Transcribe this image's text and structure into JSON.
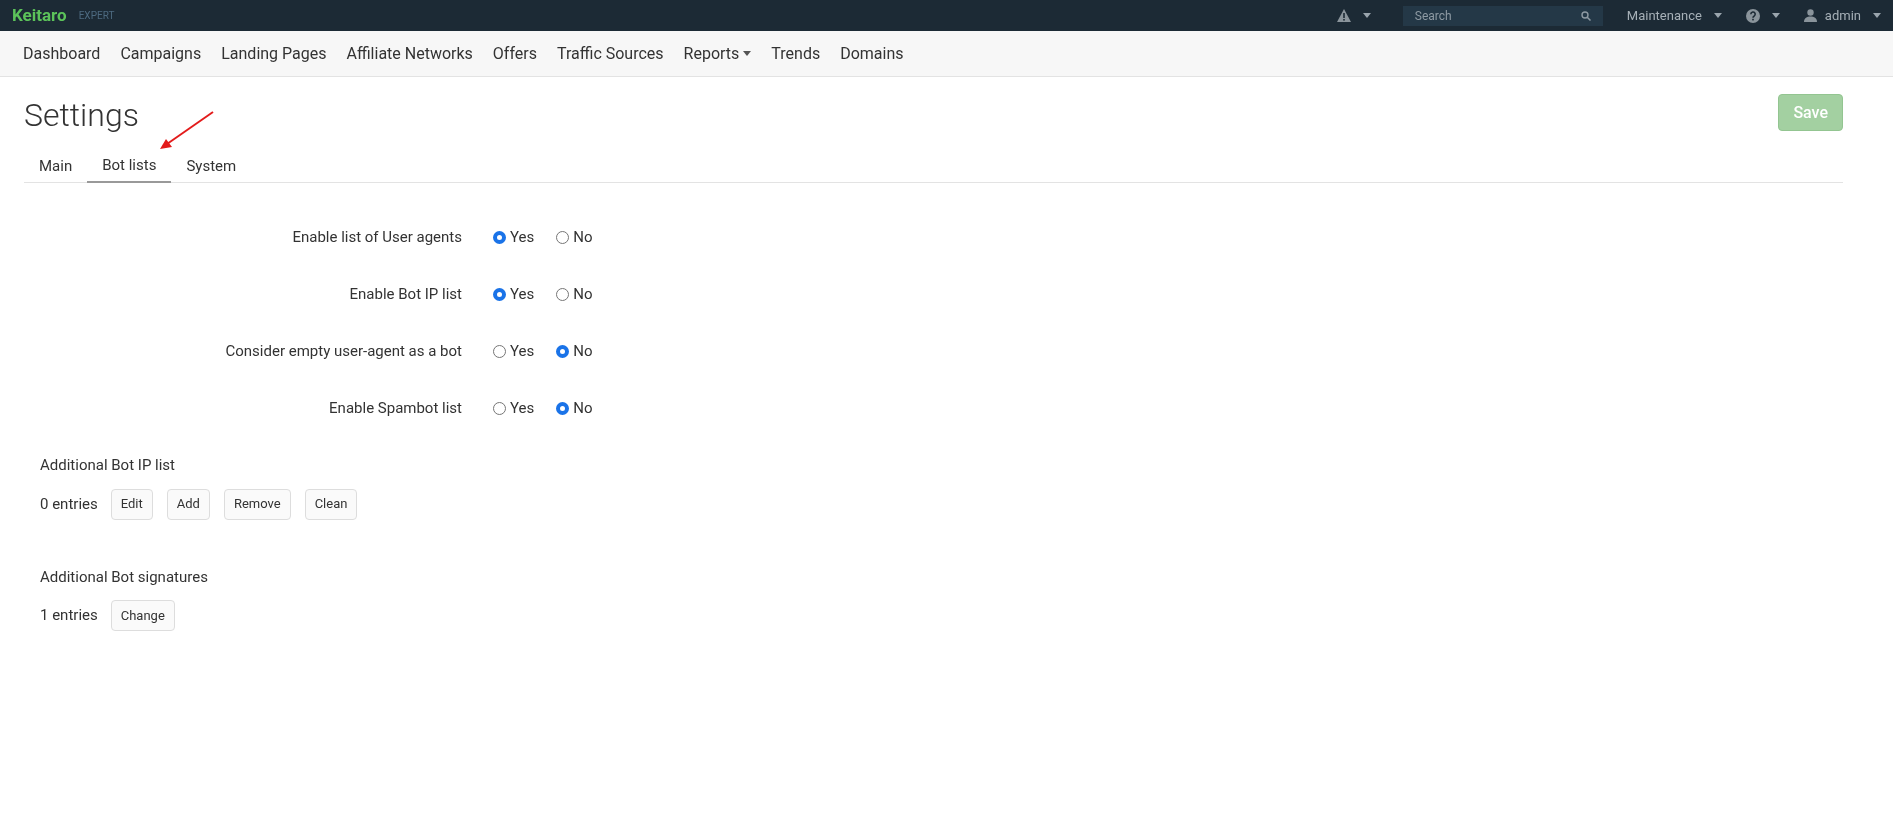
{
  "topbar": {
    "logo": "Keitaro",
    "edition": "EXPERT",
    "search": {
      "placeholder": "Search"
    },
    "menus": [
      {
        "kind": "alert"
      },
      {
        "kind": "text",
        "label": "Maintenance"
      },
      {
        "kind": "help"
      },
      {
        "kind": "user",
        "label": "admin"
      }
    ]
  },
  "nav": [
    {
      "label": "Dashboard",
      "dropdown": false
    },
    {
      "label": "Campaigns",
      "dropdown": false
    },
    {
      "label": "Landing Pages",
      "dropdown": false
    },
    {
      "label": "Affiliate Networks",
      "dropdown": false
    },
    {
      "label": "Offers",
      "dropdown": false
    },
    {
      "label": "Traffic Sources",
      "dropdown": false
    },
    {
      "label": "Reports",
      "dropdown": true
    },
    {
      "label": "Trends",
      "dropdown": false
    },
    {
      "label": "Domains",
      "dropdown": false
    }
  ],
  "page": {
    "title": "Settings",
    "save_button": {
      "label": "Save",
      "disabled": true
    }
  },
  "tabs": [
    {
      "label": "Main",
      "selected": false
    },
    {
      "label": "Bot lists",
      "selected": true
    },
    {
      "label": "System",
      "selected": false
    }
  ],
  "annotation": {
    "kind": "arrow"
  },
  "settings": [
    {
      "label": "Enable list of User agents",
      "options": [
        {
          "label": "Yes",
          "selected": true
        },
        {
          "label": "No",
          "selected": false
        }
      ]
    },
    {
      "label": "Enable Bot IP list",
      "options": [
        {
          "label": "Yes",
          "selected": true
        },
        {
          "label": "No",
          "selected": false
        }
      ]
    },
    {
      "label": "Consider empty user-agent as a bot",
      "options": [
        {
          "label": "Yes",
          "selected": false
        },
        {
          "label": "No",
          "selected": true
        }
      ]
    },
    {
      "label": "Enable Spambot list",
      "options": [
        {
          "label": "Yes",
          "selected": false
        },
        {
          "label": "No",
          "selected": true
        }
      ]
    }
  ],
  "sections": [
    {
      "title": "Additional Bot IP list",
      "count": "0 entries",
      "buttons": [
        "Edit",
        "Add",
        "Remove",
        "Clean"
      ]
    },
    {
      "title": "Additional Bot signatures",
      "count": "1 entries",
      "buttons": [
        "Change"
      ]
    }
  ]
}
